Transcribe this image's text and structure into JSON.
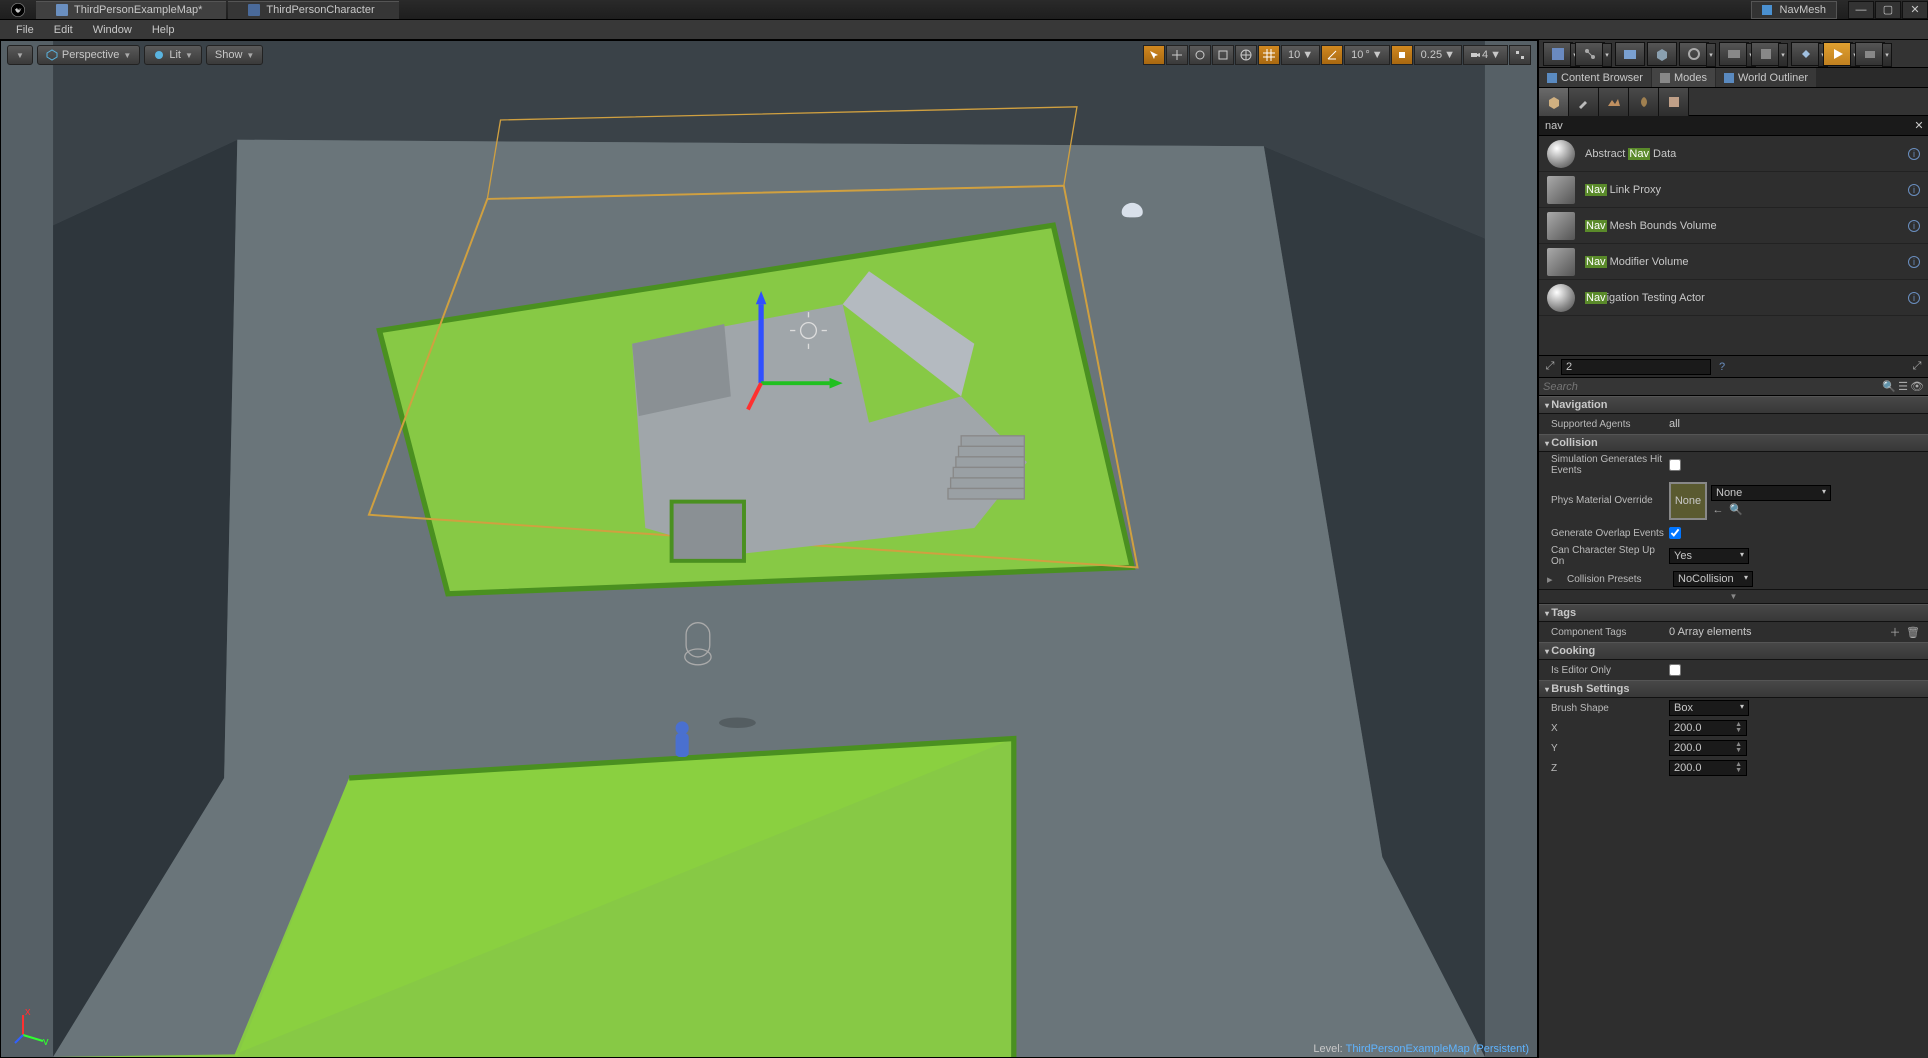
{
  "titlebar": {
    "tabs": [
      {
        "label": "ThirdPersonExampleMap*"
      },
      {
        "label": "ThirdPersonCharacter"
      }
    ],
    "search_area": "NavMesh"
  },
  "menubar": {
    "items": [
      "File",
      "Edit",
      "Window",
      "Help"
    ]
  },
  "viewport": {
    "dropdown": "",
    "perspective": "Perspective",
    "lit": "Lit",
    "show": "Show",
    "snap_grid": "10",
    "snap_angle": "10",
    "snap_scale": "0.25",
    "camera_speed": "4"
  },
  "statusbar": {
    "prefix": "Level:  ",
    "level": "ThirdPersonExampleMap (Persistent)"
  },
  "panel_tabs": {
    "content": "Content Browser",
    "modes": "Modes",
    "outliner": "World Outliner"
  },
  "modes": {
    "search_value": "nav",
    "items": [
      {
        "pre": "Abstract ",
        "hl": "Nav",
        "post": " Data",
        "thumb": "sphere"
      },
      {
        "pre": "",
        "hl": "Nav",
        "post": " Link Proxy",
        "thumb": "cube"
      },
      {
        "pre": "",
        "hl": "Nav",
        "post": " Mesh Bounds Volume",
        "thumb": "cube"
      },
      {
        "pre": "",
        "hl": "Nav",
        "post": " Modifier Volume",
        "thumb": "cube"
      },
      {
        "pre": "",
        "hl": "Nav",
        "post": "igation Testing Actor",
        "thumb": "sphere"
      }
    ]
  },
  "details": {
    "selected_count": "2",
    "search_placeholder": "Search",
    "sections": {
      "nav": {
        "title": "Navigation",
        "supported_agents_label": "Supported Agents",
        "supported_agents": "all"
      },
      "collision": {
        "title": "Collision",
        "sim_hit_label": "Simulation Generates Hit Events",
        "sim_hit": false,
        "phys_mat_label": "Phys Material Override",
        "phys_mat": "None",
        "phys_mat_thumb": "None",
        "gen_overlap_label": "Generate Overlap Events",
        "gen_overlap": true,
        "step_up_label": "Can Character Step Up On",
        "step_up": "Yes",
        "presets_label": "Collision Presets",
        "presets": "NoCollision"
      },
      "tags": {
        "title": "Tags",
        "component_tags_label": "Component Tags",
        "component_tags": "0 Array elements"
      },
      "cooking": {
        "title": "Cooking",
        "editor_only_label": "Is Editor Only",
        "editor_only": false
      },
      "brush": {
        "title": "Brush Settings",
        "shape_label": "Brush Shape",
        "shape": "Box",
        "x_label": "X",
        "x": "200.0",
        "y_label": "Y",
        "y": "200.0",
        "z_label": "Z",
        "z": "200.0"
      }
    }
  }
}
